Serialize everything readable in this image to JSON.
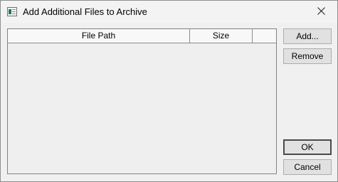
{
  "window": {
    "title": "Add Additional Files to Archive",
    "app_icon": "archive-window-icon",
    "close_icon": "close-icon"
  },
  "file_list": {
    "columns": [
      "File Path",
      "Size",
      ""
    ],
    "rows": []
  },
  "buttons": {
    "add": "Add...",
    "remove": "Remove",
    "ok": "OK",
    "cancel": "Cancel"
  }
}
